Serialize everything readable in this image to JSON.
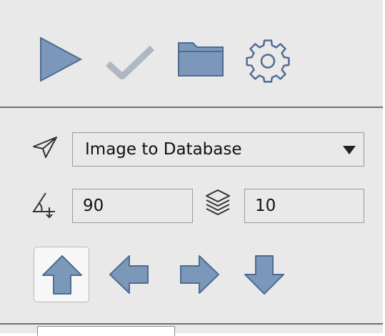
{
  "toolbar": {
    "run_icon": "play-icon",
    "check_icon": "check-icon",
    "folder_icon": "folder-icon",
    "settings_icon": "gear-icon"
  },
  "mode": {
    "icon": "send-plane-icon",
    "selected": "Image to Database"
  },
  "angle": {
    "icon": "angle-icon",
    "value": "90"
  },
  "layers": {
    "icon": "layers-icon",
    "value": "10"
  },
  "directions": {
    "selected": "up",
    "items": [
      "up",
      "left",
      "right",
      "down"
    ]
  },
  "colors": {
    "panel": "#e9e9e9",
    "icon_fill": "#7b97b9",
    "icon_stroke": "#4f6c91",
    "disabled_check": "#aeb7c2"
  }
}
